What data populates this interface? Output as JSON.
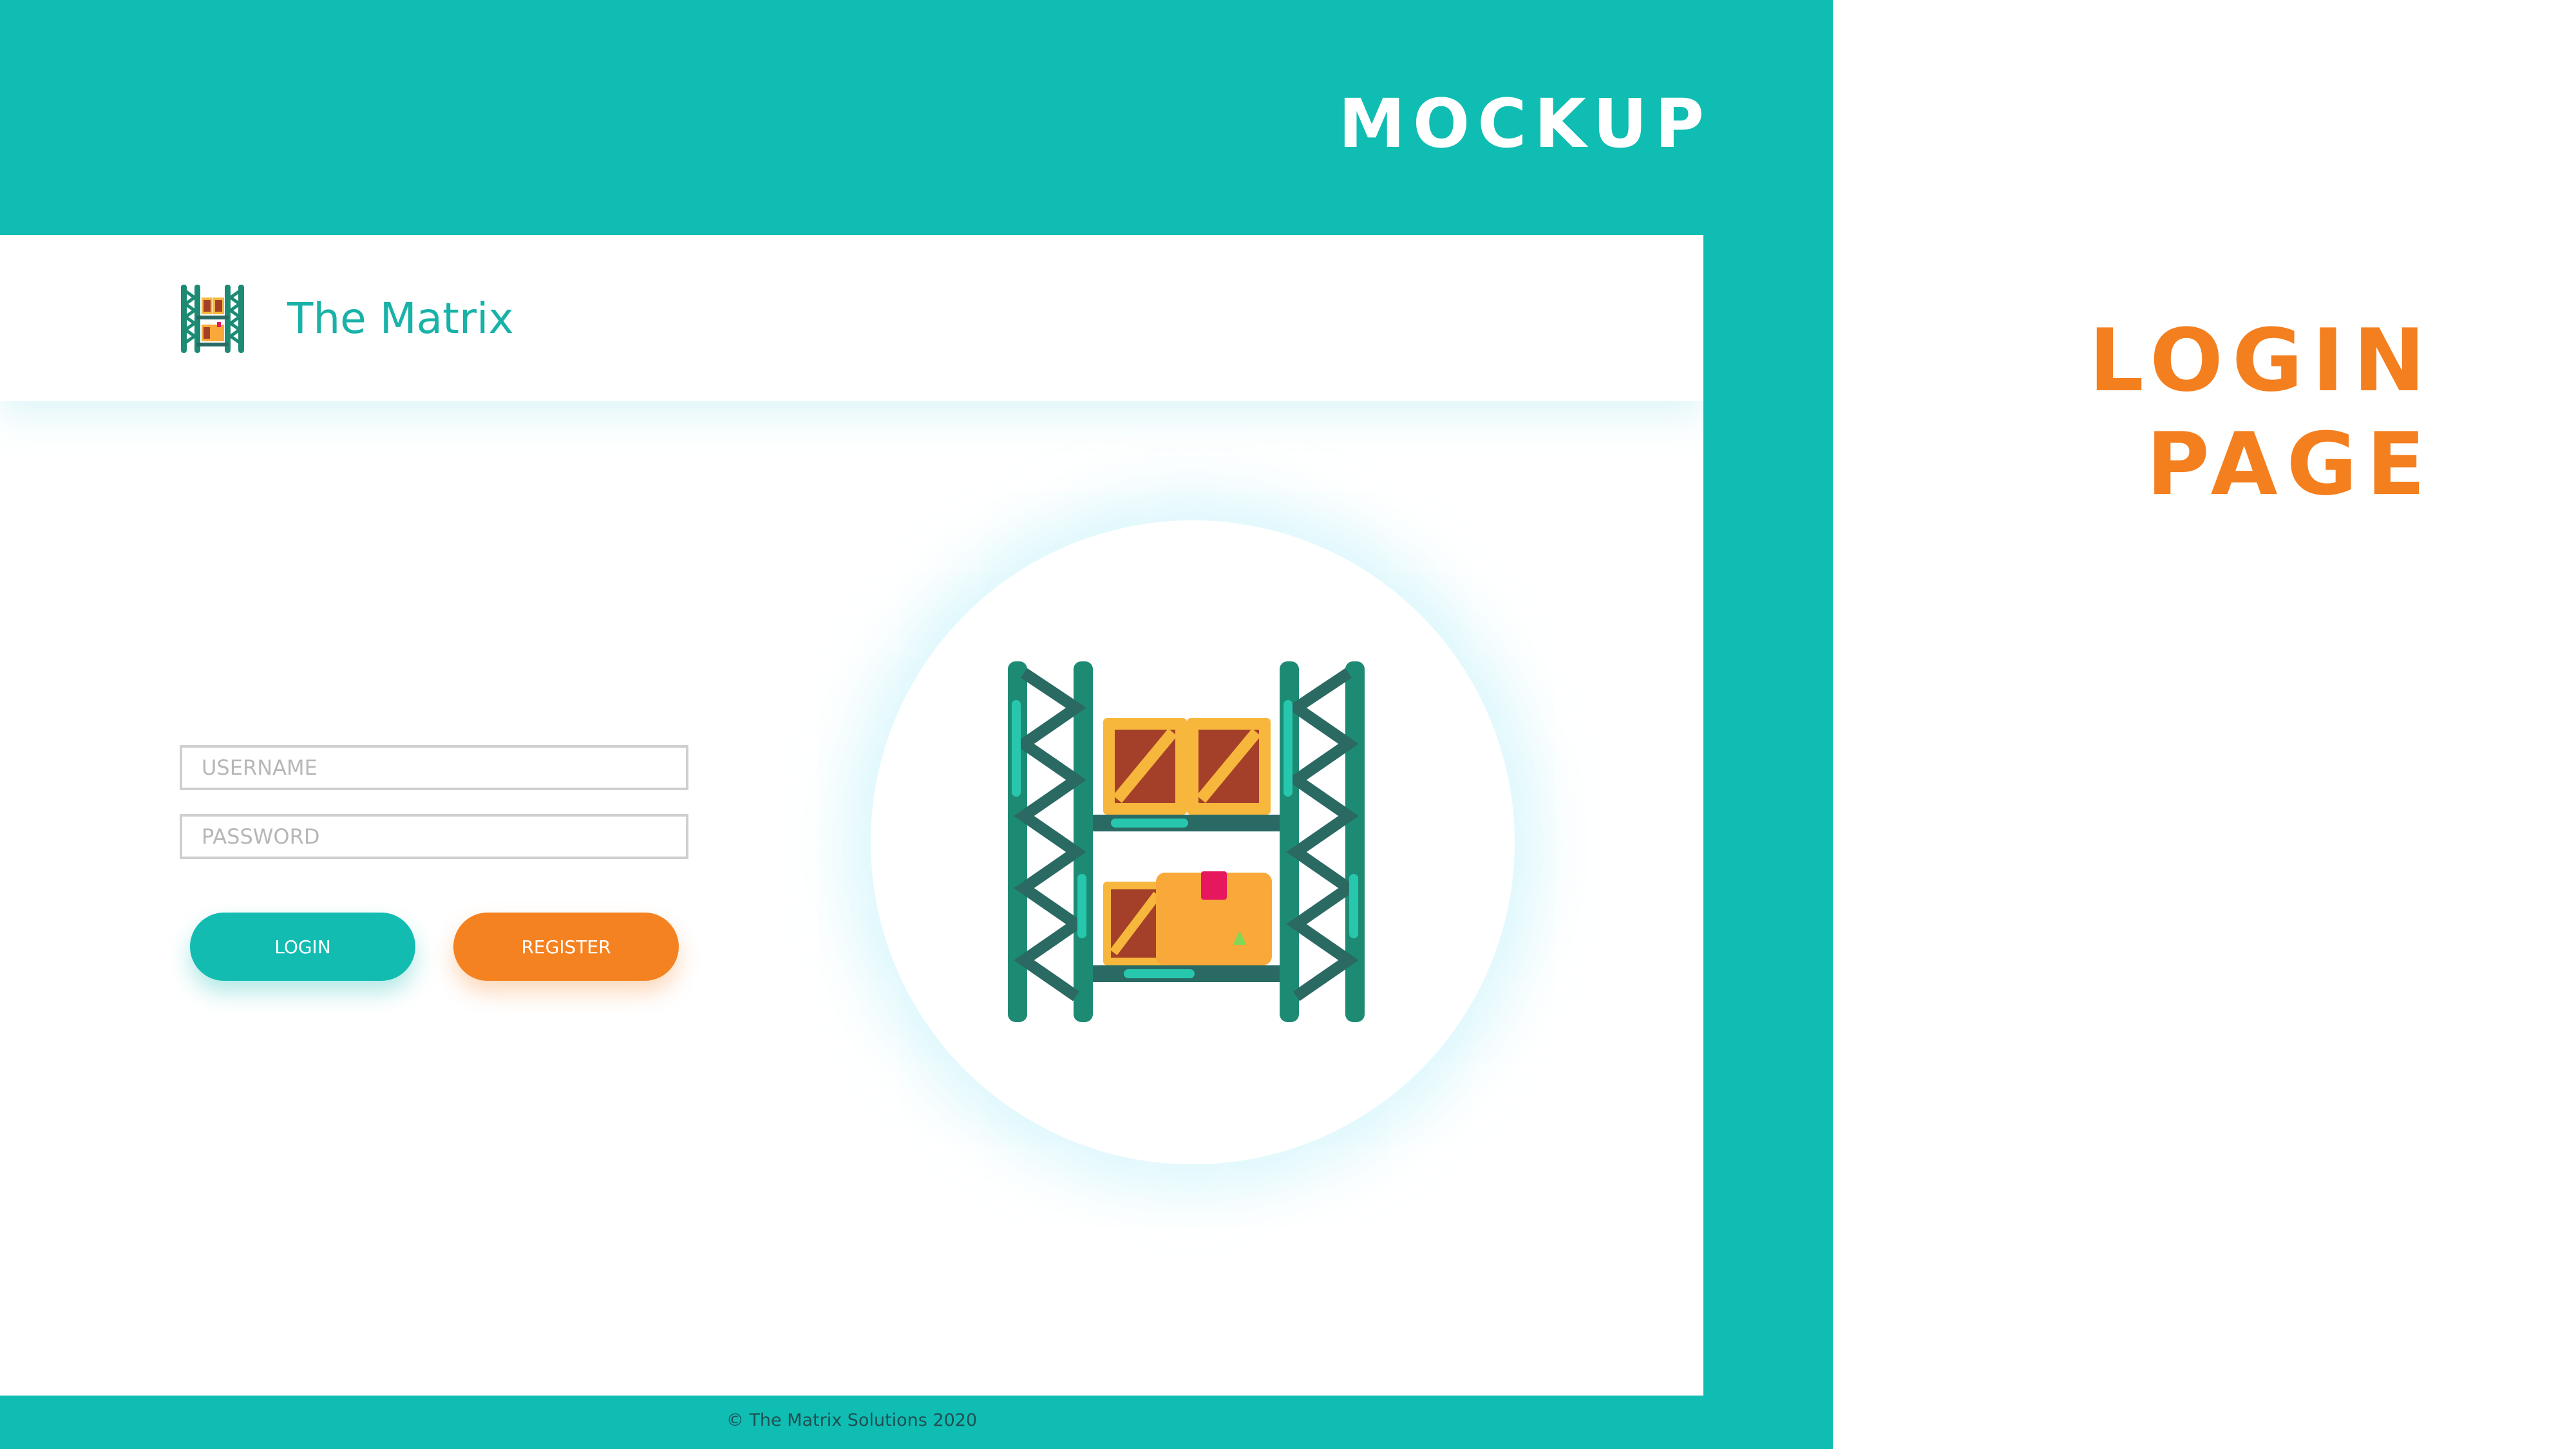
{
  "slide": {
    "mockup_label": "MOCKUP",
    "page_title_line1": "LOGIN",
    "page_title_line2": "PAGE"
  },
  "app": {
    "brand_name": "The Matrix",
    "login_form": {
      "username_placeholder": "USERNAME",
      "password_placeholder": "PASSWORD",
      "login_label": "LOGIN",
      "register_label": "REGISTER"
    },
    "footer": "© The Matrix Solutions 2020"
  },
  "colors": {
    "teal": "#0fbdb2",
    "orange": "#f47f1f",
    "shelf": "#1d8b73"
  },
  "icons": [
    "warehouse-shelf-icon"
  ]
}
